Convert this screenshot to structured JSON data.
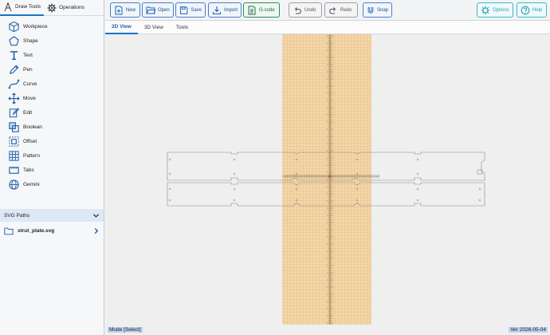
{
  "sidebar": {
    "tabs": [
      {
        "label": "Draw Tools",
        "icon": "compass-icon"
      },
      {
        "label": "Operations",
        "icon": "gear-icon"
      }
    ],
    "tools": [
      {
        "label": "Workpiece",
        "icon": "cube-icon"
      },
      {
        "label": "Shape",
        "icon": "pentagon-icon"
      },
      {
        "label": "Text",
        "icon": "text-icon"
      },
      {
        "label": "Pen",
        "icon": "pen-icon"
      },
      {
        "label": "Curve",
        "icon": "curve-icon"
      },
      {
        "label": "Move",
        "icon": "move-icon"
      },
      {
        "label": "Edit",
        "icon": "edit-icon"
      },
      {
        "label": "Boolean",
        "icon": "boolean-icon"
      },
      {
        "label": "Offset",
        "icon": "offset-icon"
      },
      {
        "label": "Pattern",
        "icon": "grid-icon"
      },
      {
        "label": "Tabs",
        "icon": "tabs-icon"
      },
      {
        "label": "Gemini",
        "icon": "gemini-icon"
      }
    ],
    "svg_paths": {
      "title": "SVG Paths",
      "file": "strut_plate.svg"
    }
  },
  "toolbar": {
    "buttons": [
      {
        "label": "New",
        "icon": "new-file-icon",
        "style": "blue"
      },
      {
        "label": "Open",
        "icon": "folder-open-icon",
        "style": "blue"
      },
      {
        "label": "Save",
        "icon": "save-icon",
        "style": "blue"
      },
      {
        "label": "Import",
        "icon": "import-icon",
        "style": "blue"
      },
      {
        "label": "G-code",
        "icon": "gcode-icon",
        "style": "green"
      },
      {
        "label": "Undo",
        "icon": "undo-icon",
        "style": "gray"
      },
      {
        "label": "Redo",
        "icon": "redo-icon",
        "style": "gray"
      },
      {
        "label": "Snap",
        "icon": "magnet-icon",
        "style": "blue"
      },
      {
        "label": "Options",
        "icon": "gear-icon",
        "style": "cyan"
      },
      {
        "label": "Help",
        "icon": "help-icon",
        "style": "cyan"
      }
    ]
  },
  "view_tabs": [
    "2D View",
    "3D View",
    "Tools"
  ],
  "active_view": "2D View",
  "canvas": {
    "material_color": "#f4d6a8",
    "grid_color": "#d9a866",
    "outline_color": "#888888"
  },
  "status": {
    "mode": "Mode [Select]",
    "version": "Ver 2026-05-04"
  },
  "colors": {
    "accent": "#1a73c9",
    "gcode": "#2f8a5a",
    "cyan": "#41b6c7"
  }
}
